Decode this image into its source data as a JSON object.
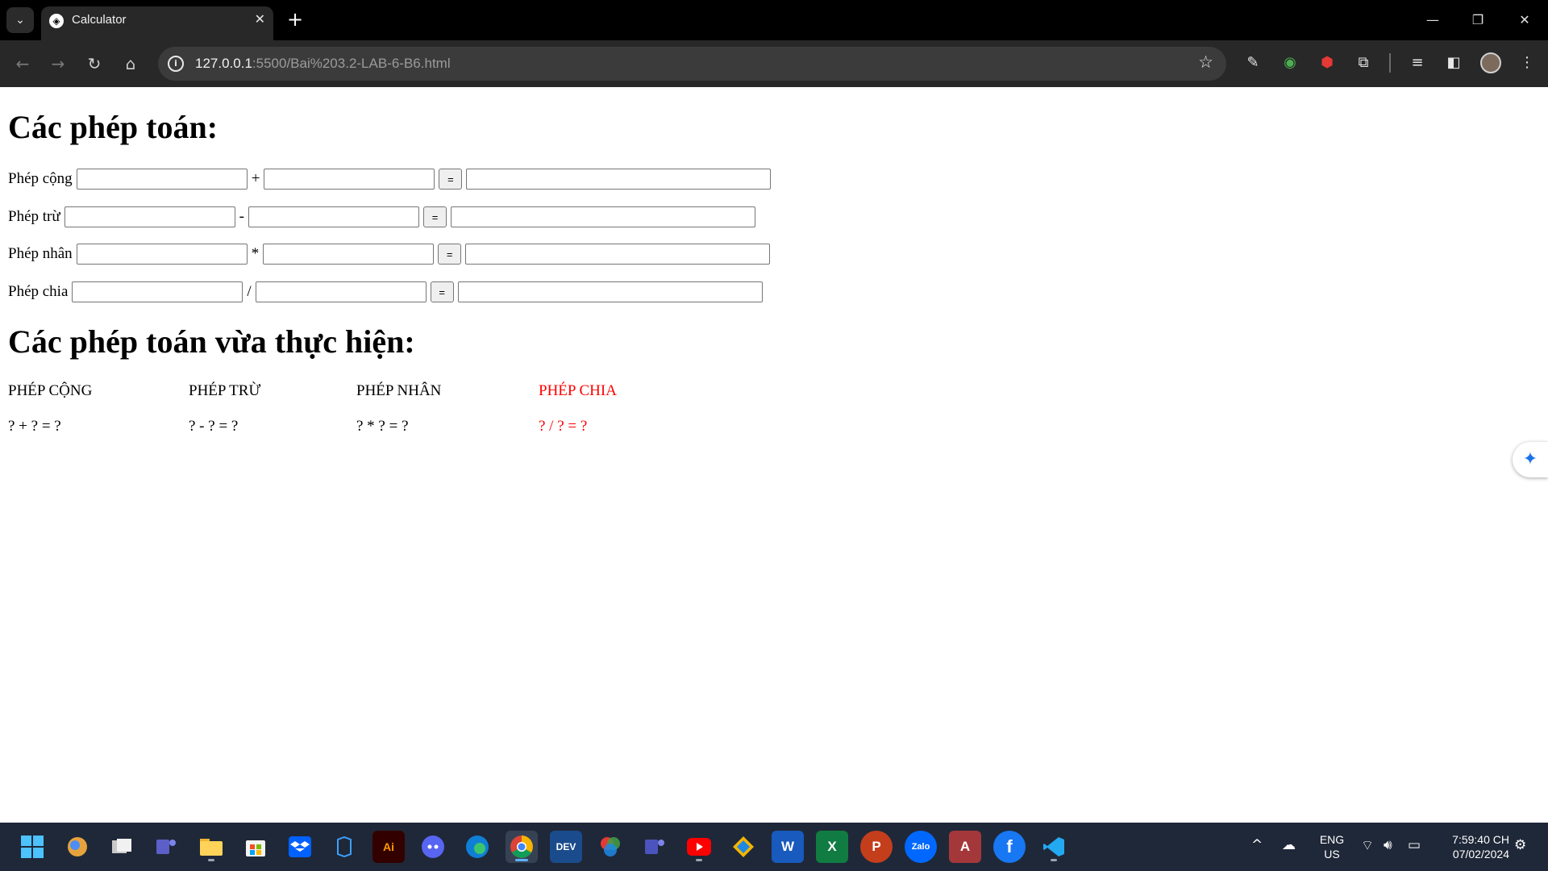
{
  "browser": {
    "tab_title": "Calculator",
    "tab_favicon": "calculator-favicon",
    "url_host": "127.0.0.1",
    "url_path": ":5500/Bai%203.2-LAB-6-B6.html",
    "tab_close_glyph": "✕",
    "new_tab_glyph": "+",
    "minimize_glyph": "—",
    "restore_glyph": "❐",
    "close_glyph": "✕"
  },
  "page": {
    "heading_ops": "Các phép toán:",
    "heading_history": "Các phép toán vừa thực hiện:",
    "operations": [
      {
        "label": "Phép cộng",
        "operator": "+",
        "operand1": "",
        "operand2": "",
        "result": "",
        "button": "="
      },
      {
        "label": "Phép trừ",
        "operator": "-",
        "operand1": "",
        "operand2": "",
        "result": "",
        "button": "="
      },
      {
        "label": "Phép nhân",
        "operator": "*",
        "operand1": "",
        "operand2": "",
        "result": "",
        "button": "="
      },
      {
        "label": "Phép chia",
        "operator": "/",
        "operand1": "",
        "operand2": "",
        "result": "",
        "button": "="
      }
    ],
    "history": [
      {
        "label": "PHÉP CỘNG",
        "expr": "? + ? = ?",
        "active": false
      },
      {
        "label": "PHÉP TRỪ",
        "expr": "? - ? = ?",
        "active": false
      },
      {
        "label": "PHÉP NHÂN",
        "expr": "? * ? = ?",
        "active": false
      },
      {
        "label": "PHÉP CHIA",
        "expr": "? / ? = ?",
        "active": true
      }
    ],
    "active_color": "#ff0000"
  },
  "taskbar": {
    "apps": [
      "start",
      "copilot-pre",
      "task-view",
      "teams",
      "file-explorer",
      "microsoft-store",
      "dropbox",
      "unknown-app",
      "illustrator",
      "discord",
      "edge",
      "chrome",
      "dev-home",
      "color-app",
      "teams-work",
      "youtube",
      "git-app",
      "word",
      "excel",
      "powerpoint",
      "zalo",
      "access",
      "facebook",
      "vscode"
    ],
    "ai_label": "Ai",
    "dev_label": "DEV",
    "word_label": "W",
    "excel_label": "X",
    "ppt_label": "P",
    "zalo_label": "Zalo",
    "access_label": "A",
    "fb_label": "f",
    "lang_line1": "ENG",
    "lang_line2": "US",
    "time": "7:59:40 CH",
    "date": "07/02/2024"
  }
}
